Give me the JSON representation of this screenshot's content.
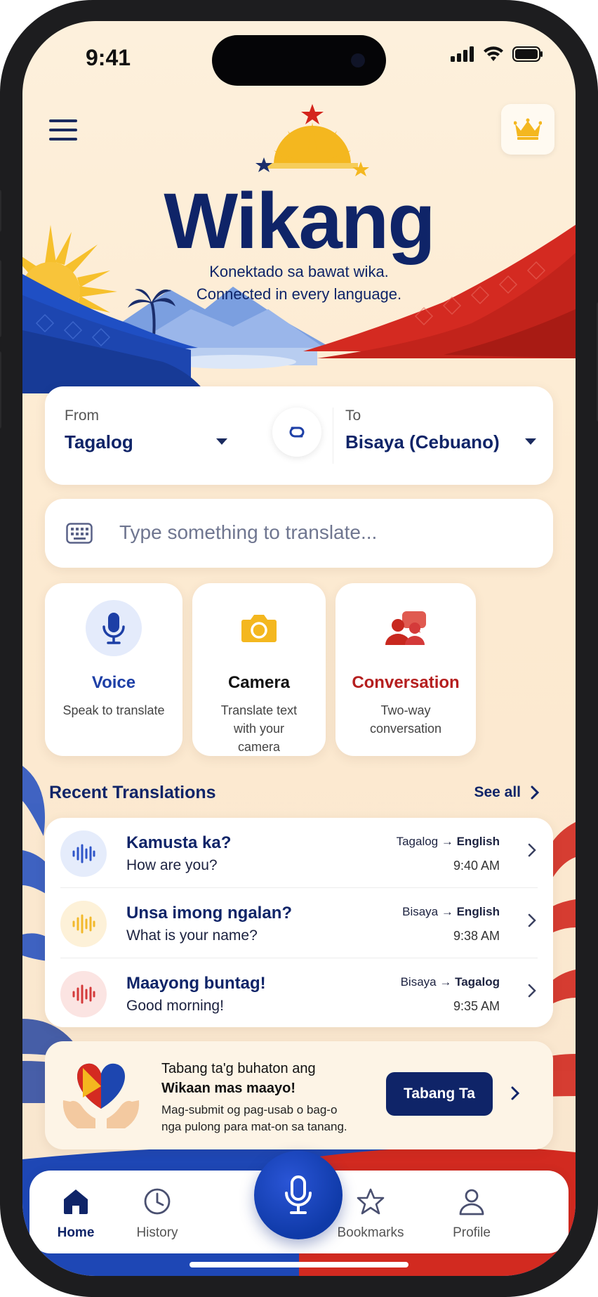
{
  "status_bar": {
    "time": "9:41"
  },
  "header": {
    "app_title": "Wikang",
    "tagline_tl": "Konektado sa bawat wika.",
    "tagline_en": "Connected in every language."
  },
  "language_selector": {
    "from_label": "From",
    "from_value": "Tagalog",
    "to_label": "To",
    "to_value": "Bisaya (Cebuano)"
  },
  "translate_input": {
    "placeholder": "Type something to translate..."
  },
  "features": [
    {
      "title": "Voice",
      "subtitle": "Speak to translate",
      "icon": "microphone-icon",
      "color": "#1d3fa6"
    },
    {
      "title": "Camera",
      "subtitle": "Translate text with your camera",
      "icon": "camera-icon",
      "color": "#111111"
    },
    {
      "title": "Conversation",
      "subtitle": "Two-way conversation",
      "icon": "conversation-icon",
      "color": "#b51f1f"
    }
  ],
  "recent": {
    "title": "Recent Translations",
    "see_all": "See all",
    "items": [
      {
        "source": "Kamusta ka?",
        "translation": "How are you?",
        "pair_from": "Tagalog",
        "pair_to": "English",
        "time": "9:40 AM",
        "accent": "#2f55c8",
        "bg": "#e5ecfb"
      },
      {
        "source": "Unsa imong ngalan?",
        "translation": "What is your name?",
        "pair_from": "Bisaya",
        "pair_to": "English",
        "time": "9:38 AM",
        "accent": "#f2b92b",
        "bg": "#fdf1d8"
      },
      {
        "source": "Maayong buntag!",
        "translation": "Good morning!",
        "pair_from": "Bisaya",
        "pair_to": "Tagalog",
        "time": "9:35 AM",
        "accent": "#d43a3a",
        "bg": "#fbe4e2"
      }
    ]
  },
  "promo": {
    "line1": "Tabang ta'g buhaton ang",
    "line2": "Wikaan mas maayo!",
    "line3": "Mag-submit og pag-usab o bag-o",
    "line4": "nga pulong para mat-on sa tanang.",
    "button": "Tabang Ta"
  },
  "nav": {
    "home": "Home",
    "history": "History",
    "bookmarks": "Bookmarks",
    "profile": "Profile",
    "active": "home"
  },
  "colors": {
    "primary": "#0f2468",
    "accent_blue": "#1d3fa6",
    "accent_red": "#c8281f",
    "accent_yellow": "#f4b71f",
    "background": "#fdf0dc"
  }
}
